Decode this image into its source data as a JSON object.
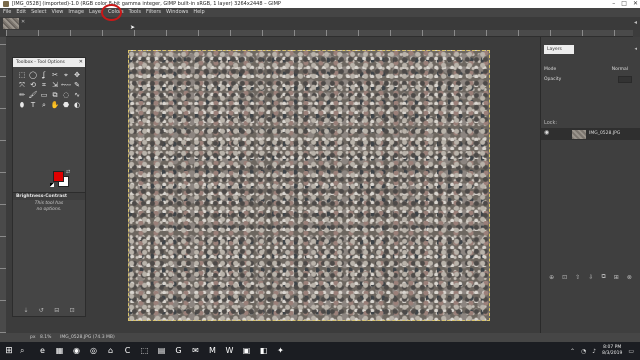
{
  "window": {
    "title": "[IMG_0528] (imported)-1.0 (RGB color 8-bit gamma integer, GIMP built-in sRGB, 1 layer) 3264x2448 – GIMP",
    "controls": [
      "–",
      "□",
      "✕"
    ]
  },
  "menubar": {
    "items": [
      "File",
      "Edit",
      "Select",
      "View",
      "Image",
      "Layer",
      "Colors",
      "Tools",
      "Filters",
      "Windows",
      "Help"
    ]
  },
  "image_tabs": {
    "close": "✕",
    "menu": "◂"
  },
  "toolbox": {
    "title": "Toolbox - Tool Options",
    "close": "✕",
    "tools": [
      "⬚",
      "◯",
      "ʆ",
      "✂",
      "⌖",
      "✥",
      "⤧",
      "⟲",
      "⌗",
      "⇲",
      "⬳",
      "✎",
      "✏",
      "🖌",
      "▭",
      "⧉",
      "◌",
      "∿",
      "⬮",
      "T",
      "⌕",
      "✋",
      "⬣",
      "◐"
    ],
    "options_header": "Brightness-Contrast",
    "options_text": [
      "This tool has",
      "no options."
    ],
    "footer": [
      "⇣",
      "↺",
      "⊟",
      "⊡"
    ],
    "colors": {
      "foreground": "#e00000",
      "background": "#ffffff"
    }
  },
  "layers": {
    "tab": "Layers",
    "menu": "◂",
    "mode_label": "Mode",
    "mode_value": "Normal",
    "opacity_label": "Opacity",
    "lock_label": "Lock:",
    "layer_name": "IMG_0528.JPG",
    "footer": [
      "⊕",
      "⊡",
      "⇧",
      "⇩",
      "⧉",
      "⊞",
      "⊗"
    ]
  },
  "statusbar": {
    "unit": "px",
    "zoom": "8.1%",
    "file": "IMG_0528.JPG (74.3 MB)"
  },
  "taskbar": {
    "start": "⊞",
    "search": "⌕",
    "apps": [
      "e",
      "▦",
      "◉",
      "◎",
      "⌂",
      "C",
      "⬚",
      "▤",
      "G",
      "✉",
      "M",
      "W",
      "▣",
      "◧",
      "✦"
    ],
    "clock_time": "8:07 PM",
    "clock_date": "8/3/2019"
  },
  "theme": {
    "accent_circle": "#c81818",
    "selection_border": "#d8c36a"
  }
}
